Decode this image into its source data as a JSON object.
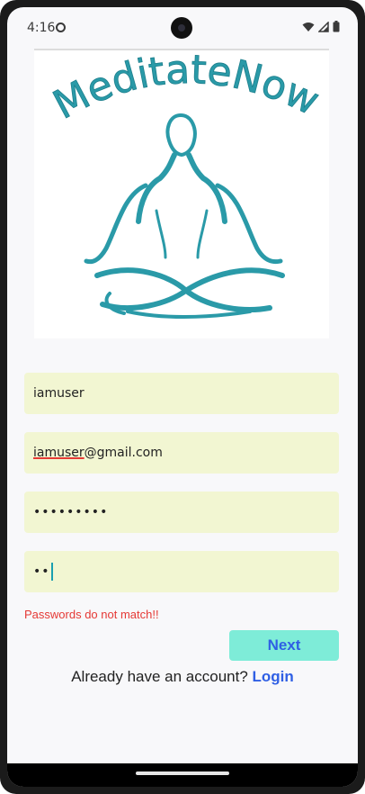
{
  "status_bar": {
    "time": "4:16",
    "icons": [
      "settings-dot-icon",
      "wifi-icon",
      "signal-icon",
      "battery-icon"
    ]
  },
  "logo": {
    "brand_text": "MeditateNow",
    "icon": "meditation-pose-icon",
    "color": "#2a9aa8"
  },
  "form": {
    "username_value": "iamuser",
    "email_value_underlined": "iamuser",
    "email_value_rest": "@gmail.com",
    "password_value": "•••••••••",
    "confirm_password_value": "••",
    "error_message": "Passwords do not match!!",
    "next_label": "Next"
  },
  "footer": {
    "prompt": "Already have an account?",
    "login_label": "Login"
  },
  "colors": {
    "field_bg": "#f2f6d2",
    "button_bg": "#7eecd8",
    "accent_blue": "#2f5fe4",
    "error_red": "#e53935"
  }
}
